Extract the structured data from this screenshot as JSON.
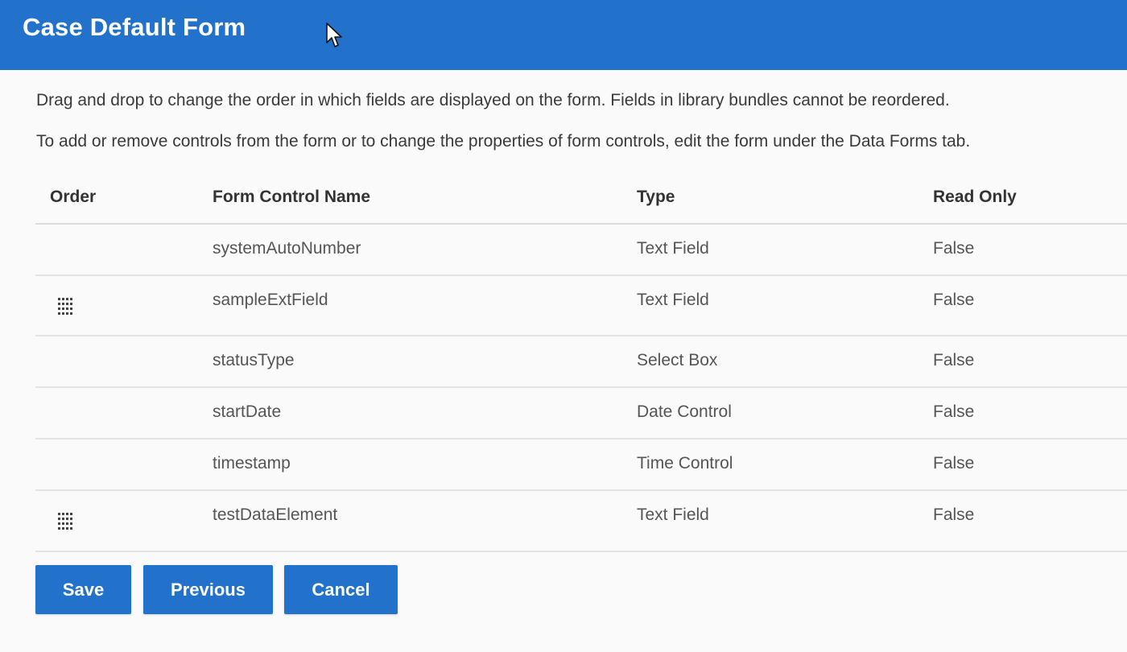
{
  "header": {
    "title": "Case Default Form"
  },
  "description": {
    "line1": "Drag and drop to change the order in which fields are displayed on the form. Fields in library bundles cannot be reordered.",
    "line2": "To add or remove controls from the form or to change the properties of form controls, edit the form under the Data Forms tab."
  },
  "table": {
    "columns": [
      "Order",
      "Form Control Name",
      "Type",
      "Read Only"
    ],
    "rows": [
      {
        "name": "systemAutoNumber",
        "type": "Text Field",
        "read_only": "False",
        "draggable": false
      },
      {
        "name": "sampleExtField",
        "type": "Text Field",
        "read_only": "False",
        "draggable": true
      },
      {
        "name": "statusType",
        "type": "Select Box",
        "read_only": "False",
        "draggable": false
      },
      {
        "name": "startDate",
        "type": "Date Control",
        "read_only": "False",
        "draggable": false
      },
      {
        "name": "timestamp",
        "type": "Time Control",
        "read_only": "False",
        "draggable": false
      },
      {
        "name": "testDataElement",
        "type": "Text Field",
        "read_only": "False",
        "draggable": true
      }
    ]
  },
  "buttons": {
    "save": "Save",
    "previous": "Previous",
    "cancel": "Cancel"
  },
  "icons": {
    "drag": "drag-handle-icon",
    "cursor": "mouse-pointer-icon"
  },
  "colors": {
    "brand": "#2272cc"
  }
}
